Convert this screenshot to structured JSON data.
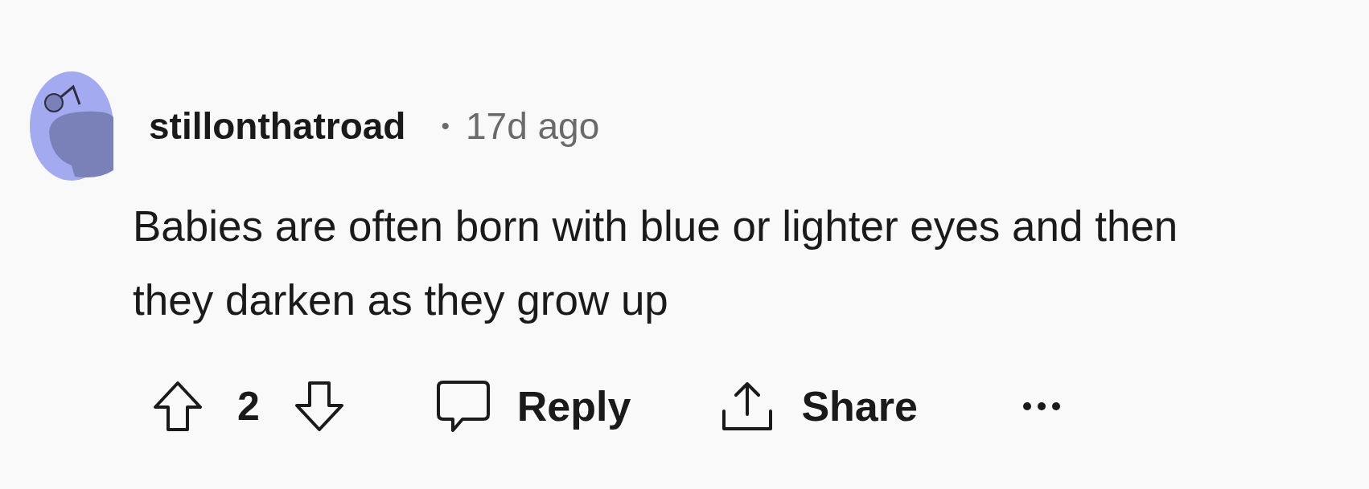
{
  "comment": {
    "author": "stillonthatroad",
    "separator": "•",
    "time": "17d ago",
    "body": "Babies are often born with blue or lighter eyes and then they darken as they grow up",
    "votes": {
      "score": "2"
    },
    "actions": [
      {
        "kind": "reply",
        "label": "Reply"
      },
      {
        "kind": "share",
        "label": "Share"
      },
      {
        "kind": "more"
      }
    ]
  }
}
